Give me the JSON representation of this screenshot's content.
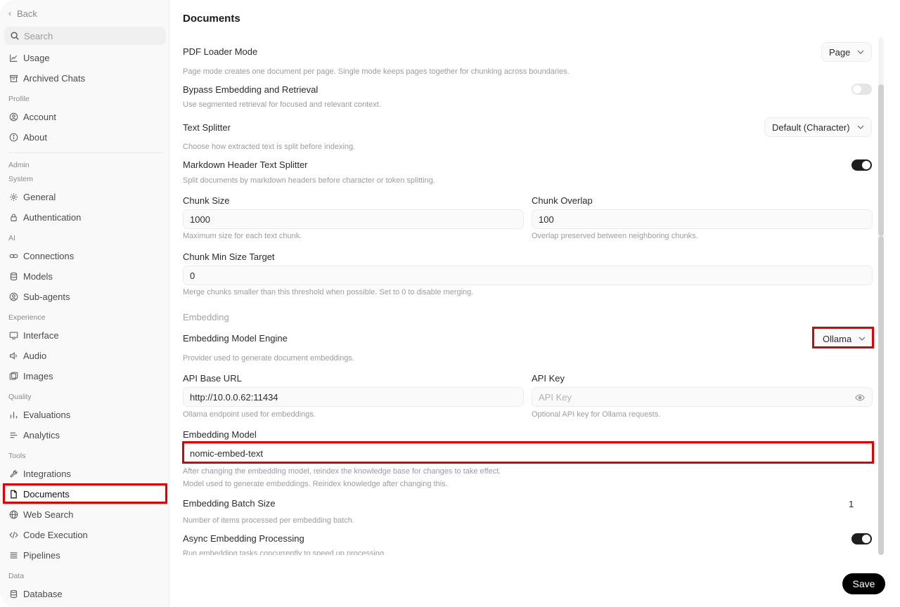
{
  "sidebar": {
    "back": "Back",
    "search_placeholder": "Search",
    "items_top": [
      {
        "label": "Usage",
        "icon": "chart-line-icon"
      },
      {
        "label": "Archived Chats",
        "icon": "archive-icon"
      }
    ],
    "profile_section": "Profile",
    "profile_items": [
      {
        "label": "Account",
        "icon": "user-circle-icon"
      },
      {
        "label": "About",
        "icon": "info-icon"
      }
    ],
    "admin_section": "Admin",
    "system_section": "System",
    "system_items": [
      {
        "label": "General",
        "icon": "gear-icon"
      },
      {
        "label": "Authentication",
        "icon": "lock-icon"
      }
    ],
    "ai_section": "AI",
    "ai_items": [
      {
        "label": "Connections",
        "icon": "link-icon"
      },
      {
        "label": "Models",
        "icon": "database-icon"
      },
      {
        "label": "Sub-agents",
        "icon": "user-circle-icon"
      }
    ],
    "experience_section": "Experience",
    "experience_items": [
      {
        "label": "Interface",
        "icon": "monitor-icon"
      },
      {
        "label": "Audio",
        "icon": "speaker-icon"
      },
      {
        "label": "Images",
        "icon": "images-icon"
      }
    ],
    "quality_section": "Quality",
    "quality_items": [
      {
        "label": "Evaluations",
        "icon": "bar-chart-icon"
      },
      {
        "label": "Analytics",
        "icon": "list-icon"
      }
    ],
    "tools_section": "Tools",
    "tools_items": [
      {
        "label": "Integrations",
        "icon": "wrench-icon"
      },
      {
        "label": "Documents",
        "icon": "document-icon"
      },
      {
        "label": "Web Search",
        "icon": "globe-icon"
      },
      {
        "label": "Code Execution",
        "icon": "code-icon"
      },
      {
        "label": "Pipelines",
        "icon": "layers-icon"
      }
    ],
    "data_section": "Data",
    "data_items": [
      {
        "label": "Database",
        "icon": "database-icon"
      }
    ],
    "active_item": "Documents"
  },
  "main": {
    "title": "Documents",
    "pdf_loader_mode": {
      "label": "PDF Loader Mode",
      "value": "Page",
      "help": "Page mode creates one document per page. Single mode keeps pages together for chunking across boundaries."
    },
    "bypass": {
      "label": "Bypass Embedding and Retrieval",
      "help": "Use segmented retrieval for focused and relevant context.",
      "enabled": false
    },
    "text_splitter": {
      "label": "Text Splitter",
      "value": "Default (Character)",
      "help": "Choose how extracted text is split before indexing."
    },
    "markdown_splitter": {
      "label": "Markdown Header Text Splitter",
      "help": "Split documents by markdown headers before character or token splitting.",
      "enabled": true
    },
    "chunk_size": {
      "label": "Chunk Size",
      "value": "1000",
      "help": "Maximum size for each text chunk."
    },
    "chunk_overlap": {
      "label": "Chunk Overlap",
      "value": "100",
      "help": "Overlap preserved between neighboring chunks."
    },
    "chunk_min": {
      "label": "Chunk Min Size Target",
      "value": "0",
      "help": "Merge chunks smaller than this threshold when possible. Set to 0 to disable merging."
    },
    "embedding_section": "Embedding",
    "embedding_engine": {
      "label": "Embedding Model Engine",
      "value": "Ollama",
      "help": "Provider used to generate document embeddings."
    },
    "api_base_url": {
      "label": "API Base URL",
      "value": "http://10.0.0.62:11434",
      "help": "Ollama endpoint used for embeddings."
    },
    "api_key": {
      "label": "API Key",
      "placeholder": "API Key",
      "help": "Optional API key for Ollama requests."
    },
    "embedding_model": {
      "label": "Embedding Model",
      "value": "nomic-embed-text",
      "help1": "After changing the embedding model, reindex the knowledge base for changes to take effect.",
      "help2": "Model used to generate embeddings. Reindex knowledge after changing this."
    },
    "batch_size": {
      "label": "Embedding Batch Size",
      "value": "1",
      "help": "Number of items processed per embedding batch."
    },
    "async": {
      "label": "Async Embedding Processing",
      "help": "Run embedding tasks concurrently to speed up processing.",
      "enabled": true
    },
    "save": "Save"
  },
  "colors": {
    "highlight": "#e00000",
    "toggle_on": "#1e1e1e",
    "toggle_off": "#e5e5e5",
    "save_bg": "#000000"
  }
}
